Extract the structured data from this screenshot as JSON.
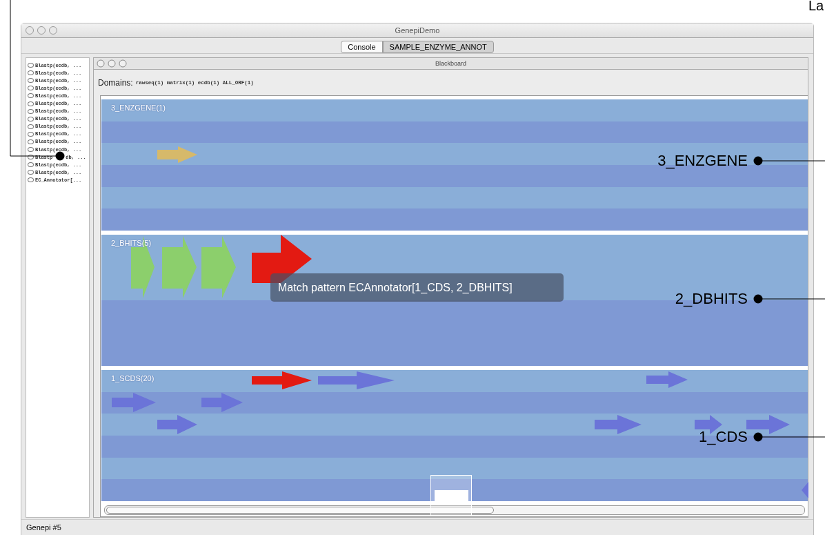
{
  "window": {
    "title": "GenepiDemo"
  },
  "tabs": [
    {
      "label": "Console",
      "selected": false
    },
    {
      "label": "SAMPLE_ENZYME_ANNOT",
      "selected": true
    }
  ],
  "process_list": {
    "items": [
      {
        "label": "Blastp(ecdb, ...",
        "selected": false
      },
      {
        "label": "Blastp(ecdb, ...",
        "selected": false
      },
      {
        "label": "Blastp(ecdb, ...",
        "selected": false
      },
      {
        "label": "Blastp(ecdb, ...",
        "selected": false
      },
      {
        "label": "Blastp(ecdb, ...",
        "selected": false
      },
      {
        "label": "Blastp(ecdb, ...",
        "selected": false
      },
      {
        "label": "Blastp(ecdb, ...",
        "selected": false
      },
      {
        "label": "Blastp(ecdb, ...",
        "selected": false
      },
      {
        "label": "Blastp(ecdb, ...",
        "selected": false
      },
      {
        "label": "Blastp(ecdb, ...",
        "selected": false
      },
      {
        "label": "Blastp(ecdb, ...",
        "selected": false
      },
      {
        "label": "Blastp(ecdb, ...",
        "selected": false
      },
      {
        "label": "Blastp",
        "label_end": "db, ...",
        "selected": false
      },
      {
        "label": "Blastp(ecdb, ...",
        "selected": false
      },
      {
        "label": "Blastp(ecdb, ...",
        "selected": false
      },
      {
        "label": "EC_Annotator[...",
        "selected": false
      }
    ]
  },
  "blackboard": {
    "title": "Blackboard",
    "domains_label": "Domains:",
    "domains": "rawseq(1) matrix(1) ecdb(1) ALL_ORF(1)",
    "groups": [
      {
        "label": "3_ENZGENE(1)",
        "rows": [
          {
            "kind": "light"
          },
          {
            "kind": "dark"
          },
          {
            "kind": "light"
          },
          {
            "kind": "dark"
          },
          {
            "kind": "light"
          },
          {
            "kind": "dark"
          }
        ]
      },
      {
        "label": "2_BHITS(5)",
        "rows": [
          {
            "kind": "light"
          },
          {
            "kind": "dark"
          }
        ]
      },
      {
        "label": "1_SCDS(20)",
        "rows": [
          {
            "kind": "light"
          },
          {
            "kind": "dark"
          },
          {
            "kind": "light"
          },
          {
            "kind": "dark"
          },
          {
            "kind": "light"
          },
          {
            "kind": "dark"
          }
        ]
      }
    ],
    "tooltip": "Match pattern ECAnnotator[1_CDS, 2_DBHITS]"
  },
  "status_bar": "Genepi #5",
  "callouts": [
    {
      "label": "3_ENZGENE"
    },
    {
      "label": "2_DBHITS"
    },
    {
      "label": "1_CDS"
    },
    {
      "label": "La"
    }
  ]
}
